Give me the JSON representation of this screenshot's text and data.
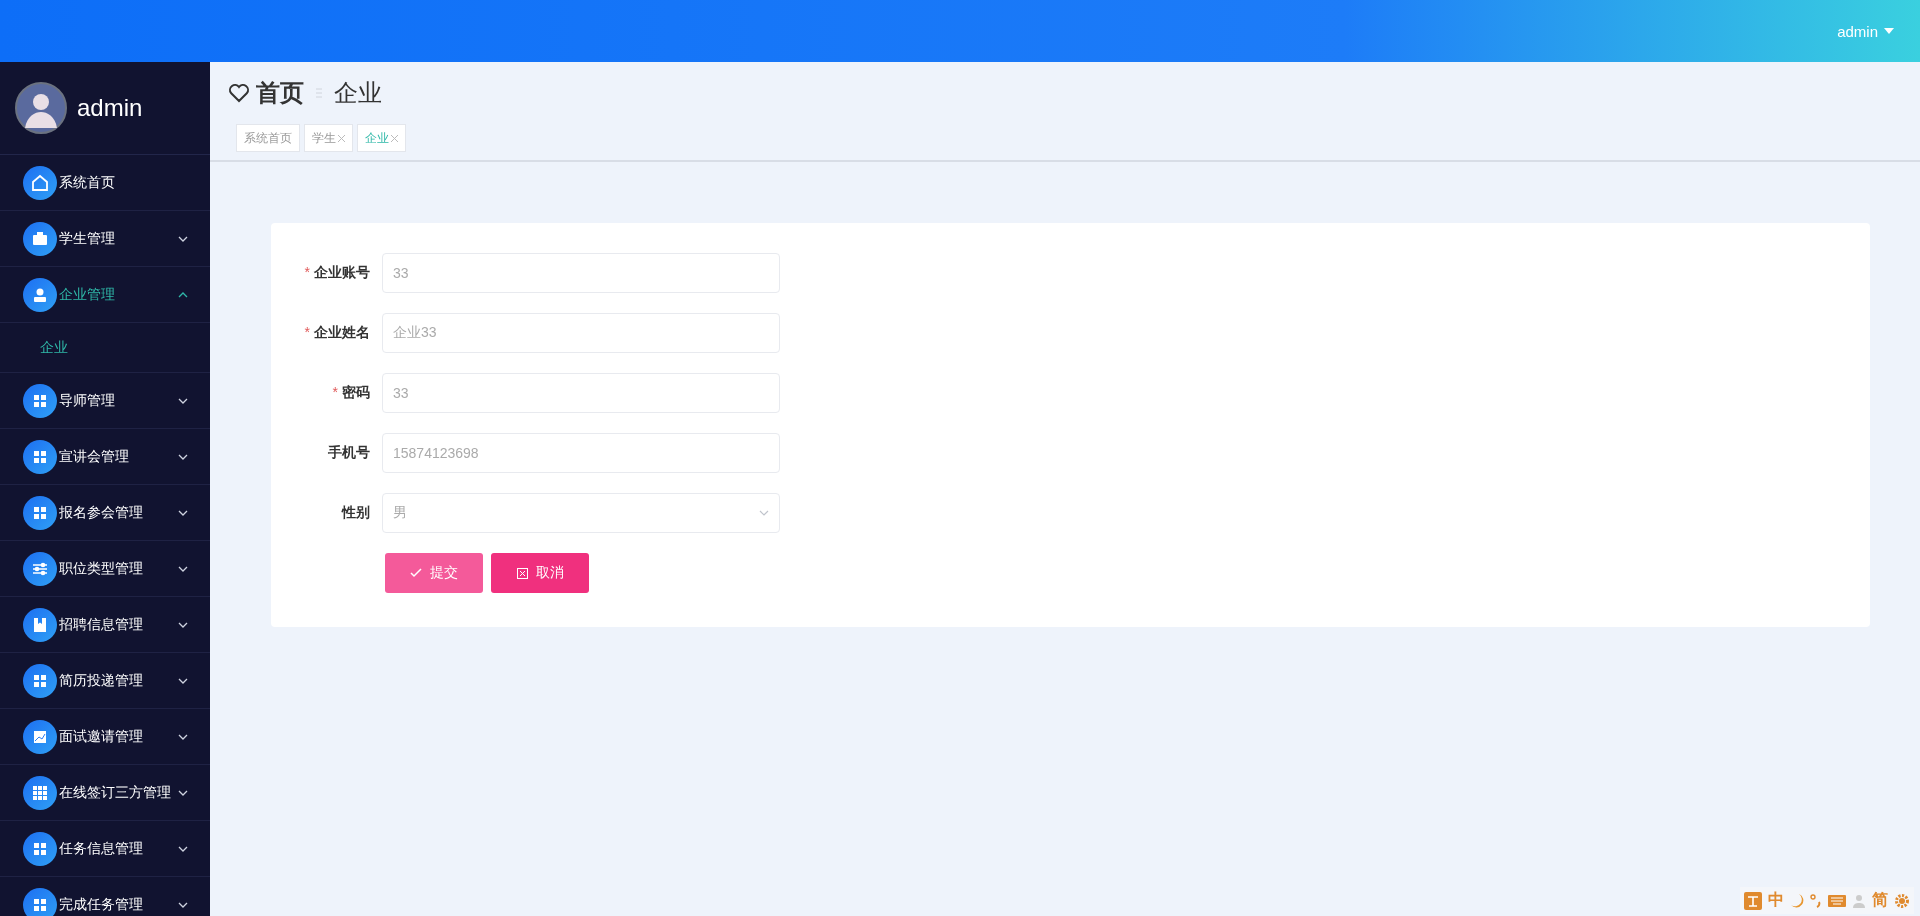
{
  "header": {
    "user": "admin"
  },
  "sidebar": {
    "user_name": "admin",
    "menu": [
      {
        "label": "系统首页",
        "kind": "home",
        "expandable": false,
        "selected": false
      },
      {
        "label": "学生管理",
        "kind": "briefcase",
        "expandable": true,
        "expanded": false,
        "selected": false
      },
      {
        "label": "企业管理",
        "kind": "user",
        "expandable": true,
        "expanded": true,
        "selected": true,
        "children": [
          {
            "label": "企业",
            "selected": true
          }
        ]
      },
      {
        "label": "导师管理",
        "kind": "grid",
        "expandable": true,
        "expanded": false,
        "selected": false
      },
      {
        "label": "宣讲会管理",
        "kind": "grid",
        "expandable": true,
        "expanded": false,
        "selected": false
      },
      {
        "label": "报名参会管理",
        "kind": "grid",
        "expandable": true,
        "expanded": false,
        "selected": false
      },
      {
        "label": "职位类型管理",
        "kind": "sliders",
        "expandable": true,
        "expanded": false,
        "selected": false
      },
      {
        "label": "招聘信息管理",
        "kind": "book",
        "expandable": true,
        "expanded": false,
        "selected": false
      },
      {
        "label": "简历投递管理",
        "kind": "grid",
        "expandable": true,
        "expanded": false,
        "selected": false
      },
      {
        "label": "面试邀请管理",
        "kind": "chart",
        "expandable": true,
        "expanded": false,
        "selected": false
      },
      {
        "label": "在线签订三方管理",
        "kind": "table",
        "expandable": true,
        "expanded": false,
        "selected": false
      },
      {
        "label": "任务信息管理",
        "kind": "grid",
        "expandable": true,
        "expanded": false,
        "selected": false
      },
      {
        "label": "完成任务管理",
        "kind": "grid",
        "expandable": true,
        "expanded": false,
        "selected": false
      }
    ]
  },
  "breadcrumb": {
    "home": "首页",
    "current": "企业"
  },
  "tabs": [
    {
      "label": "系统首页",
      "closable": false,
      "selected": false
    },
    {
      "label": "学生",
      "closable": true,
      "selected": false
    },
    {
      "label": "企业",
      "closable": true,
      "selected": true
    }
  ],
  "form": {
    "fields": [
      {
        "label": "企业账号",
        "required_mark": "*",
        "kind": "text",
        "value": "33"
      },
      {
        "label": "企业姓名",
        "required_mark": "*",
        "kind": "text",
        "value": "企业33"
      },
      {
        "label": "密码",
        "required_mark": "*",
        "kind": "text",
        "value": "33"
      },
      {
        "label": "手机号",
        "kind": "text",
        "value": "15874123698"
      },
      {
        "label": "性别",
        "kind": "select",
        "value": "男"
      }
    ],
    "buttons": [
      {
        "label": "提交",
        "kind": "submit"
      },
      {
        "label": "取消",
        "kind": "cancel"
      }
    ]
  },
  "ime_toolbar": [
    {
      "kind": "logo"
    },
    {
      "kind": "text",
      "label": "中"
    },
    {
      "kind": "moon"
    },
    {
      "kind": "punct"
    },
    {
      "kind": "keyboard"
    },
    {
      "kind": "person"
    },
    {
      "kind": "text",
      "label": "简"
    },
    {
      "kind": "gear"
    }
  ]
}
